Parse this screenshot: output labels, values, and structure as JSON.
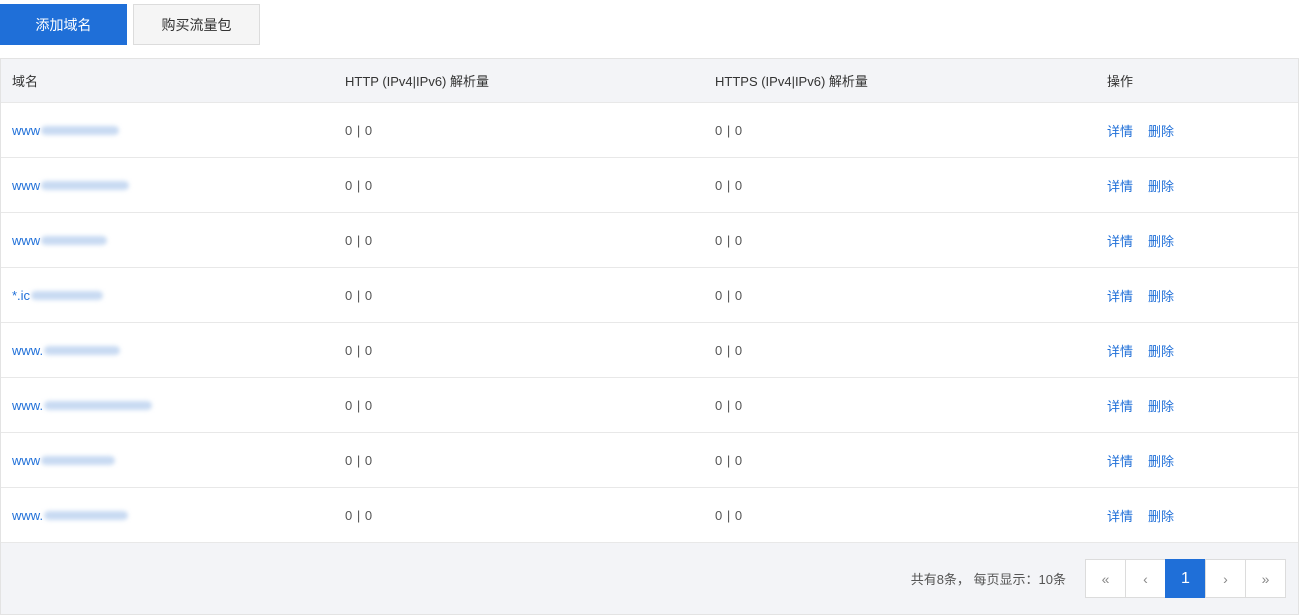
{
  "toolbar": {
    "add_label": "添加域名",
    "buy_label": "购买流量包"
  },
  "table": {
    "headers": [
      "域名",
      "HTTP (IPv4|IPv6) 解析量",
      "HTTPS (IPv4|IPv6) 解析量",
      "操作"
    ],
    "rows": [
      {
        "domain_visible": "www",
        "http": "0 | 0",
        "https": "0 | 0",
        "detail": "详情",
        "delete": "删除"
      },
      {
        "domain_visible": "www",
        "http": "0 | 0",
        "https": "0 | 0",
        "detail": "详情",
        "delete": "删除"
      },
      {
        "domain_visible": "www",
        "http": "0 | 0",
        "https": "0 | 0",
        "detail": "详情",
        "delete": "删除"
      },
      {
        "domain_visible": "*.ic",
        "http": "0 | 0",
        "https": "0 | 0",
        "detail": "详情",
        "delete": "删除"
      },
      {
        "domain_visible": "www.",
        "http": "0 | 0",
        "https": "0 | 0",
        "detail": "详情",
        "delete": "删除"
      },
      {
        "domain_visible": "www.",
        "http": "0 | 0",
        "https": "0 | 0",
        "detail": "详情",
        "delete": "删除"
      },
      {
        "domain_visible": "www",
        "http": "0 | 0",
        "https": "0 | 0",
        "detail": "详情",
        "delete": "删除"
      },
      {
        "domain_visible": "www.",
        "http": "0 | 0",
        "https": "0 | 0",
        "detail": "详情",
        "delete": "删除"
      }
    ]
  },
  "pagination": {
    "summary": "共有8条， 每页显示：10条",
    "first": "«",
    "prev": "‹",
    "current": "1",
    "next": "›",
    "last": "»"
  },
  "colors": {
    "accent": "#1f6fd8",
    "header_bg": "#f3f4f7"
  }
}
